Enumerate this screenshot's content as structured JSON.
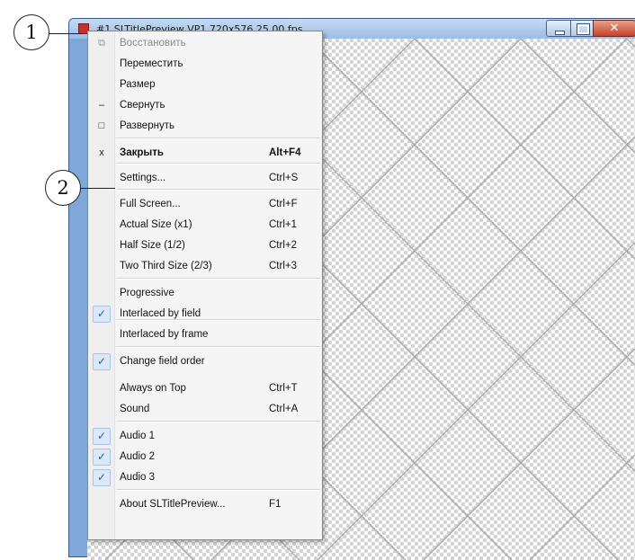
{
  "window": {
    "title": "#1 SLTitlePreview VP1 720x576 25.00 fps"
  },
  "callouts": [
    "1",
    "2"
  ],
  "menu": {
    "items": [
      {
        "label": "Восстановить",
        "shortcut": "",
        "icon": "restore-icon",
        "glyph": "⧉",
        "disabled": true,
        "checked": false,
        "bold": false
      },
      {
        "label": "Переместить",
        "shortcut": "",
        "icon": "",
        "glyph": "",
        "disabled": false,
        "checked": false,
        "bold": false
      },
      {
        "label": "Размер",
        "shortcut": "",
        "icon": "",
        "glyph": "",
        "disabled": false,
        "checked": false,
        "bold": false
      },
      {
        "label": "Свернуть",
        "shortcut": "",
        "icon": "minimize-icon",
        "glyph": "–",
        "disabled": false,
        "checked": false,
        "bold": false
      },
      {
        "label": "Развернуть",
        "shortcut": "",
        "icon": "maximize-icon",
        "glyph": "□",
        "disabled": false,
        "checked": false,
        "bold": false
      },
      {
        "label": "Закрыть",
        "shortcut": "Alt+F4",
        "icon": "close-icon",
        "glyph": "x",
        "disabled": false,
        "checked": false,
        "bold": true
      },
      {
        "label": "Settings...",
        "shortcut": "Ctrl+S",
        "icon": "",
        "glyph": "",
        "disabled": false,
        "checked": false,
        "bold": false
      },
      {
        "label": "Full Screen...",
        "shortcut": "Ctrl+F",
        "icon": "",
        "glyph": "",
        "disabled": false,
        "checked": false,
        "bold": false
      },
      {
        "label": "Actual Size (x1)",
        "shortcut": "Ctrl+1",
        "icon": "",
        "glyph": "",
        "disabled": false,
        "checked": false,
        "bold": false
      },
      {
        "label": "Half Size (1/2)",
        "shortcut": "Ctrl+2",
        "icon": "",
        "glyph": "",
        "disabled": false,
        "checked": false,
        "bold": false
      },
      {
        "label": "Two Third Size (2/3)",
        "shortcut": "Ctrl+3",
        "icon": "",
        "glyph": "",
        "disabled": false,
        "checked": false,
        "bold": false
      },
      {
        "label": "Progressive",
        "shortcut": "",
        "icon": "",
        "glyph": "",
        "disabled": false,
        "checked": false,
        "bold": false
      },
      {
        "label": "Interlaced by field",
        "shortcut": "",
        "icon": "check-icon",
        "glyph": "✓",
        "disabled": false,
        "checked": true,
        "bold": false
      },
      {
        "label": "Interlaced by frame",
        "shortcut": "",
        "icon": "",
        "glyph": "",
        "disabled": false,
        "checked": false,
        "bold": false
      },
      {
        "label": "Change field order",
        "shortcut": "",
        "icon": "check-icon",
        "glyph": "✓",
        "disabled": false,
        "checked": true,
        "bold": false
      },
      {
        "label": "Always on Top",
        "shortcut": "Ctrl+T",
        "icon": "",
        "glyph": "",
        "disabled": false,
        "checked": false,
        "bold": false
      },
      {
        "label": "Sound",
        "shortcut": "Ctrl+A",
        "icon": "",
        "glyph": "",
        "disabled": false,
        "checked": false,
        "bold": false
      },
      {
        "label": "Audio 1",
        "shortcut": "",
        "icon": "check-icon",
        "glyph": "✓",
        "disabled": false,
        "checked": true,
        "bold": false
      },
      {
        "label": "Audio 2",
        "shortcut": "",
        "icon": "check-icon",
        "glyph": "✓",
        "disabled": false,
        "checked": true,
        "bold": false
      },
      {
        "label": "Audio 3",
        "shortcut": "",
        "icon": "check-icon",
        "glyph": "✓",
        "disabled": false,
        "checked": true,
        "bold": false
      },
      {
        "label": "About SLTitlePreview...",
        "shortcut": "F1",
        "icon": "",
        "glyph": "",
        "disabled": false,
        "checked": false,
        "bold": false
      }
    ]
  },
  "colors": {
    "check": "#2a5ea8",
    "title_bar": "#9bbce6",
    "close_button": "#c4432c"
  }
}
